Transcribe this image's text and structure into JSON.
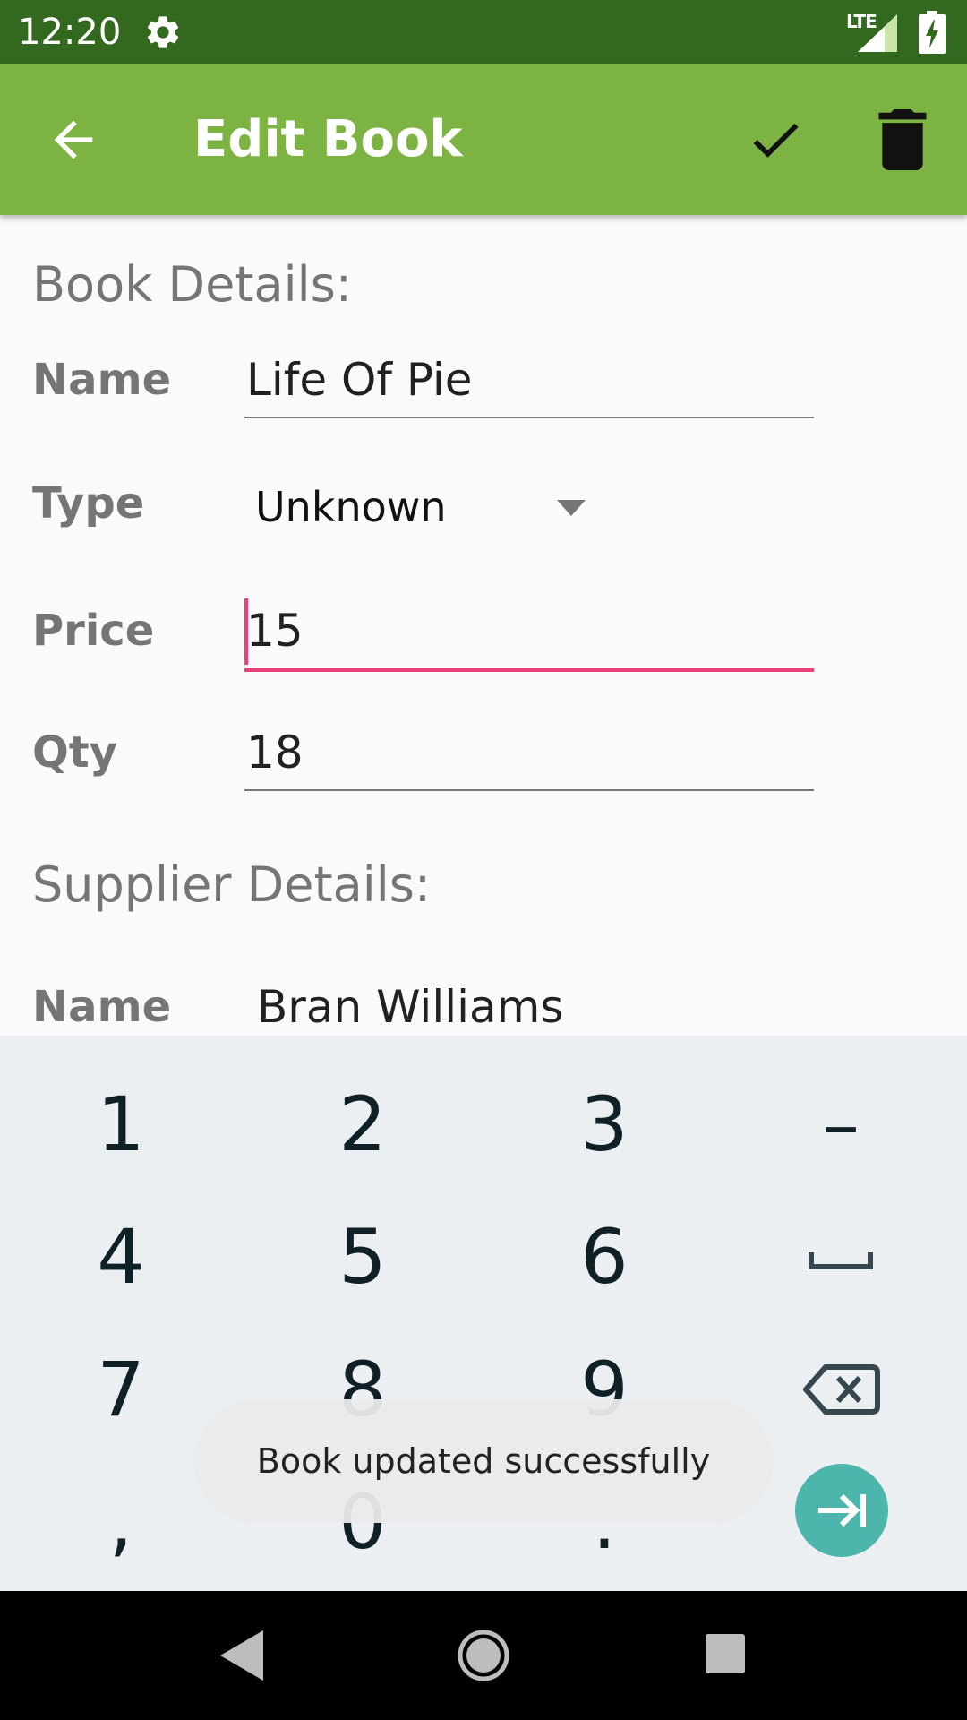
{
  "status_bar": {
    "time": "12:20",
    "network_label": "LTE",
    "icons": [
      "gear-icon",
      "signal-icon",
      "battery-charging-icon"
    ]
  },
  "app_bar": {
    "title": "Edit Book",
    "icons": [
      "arrow-left-icon",
      "check-icon",
      "trash-icon"
    ],
    "background": "#7cb342"
  },
  "book_details": {
    "header": "Book Details:",
    "name_label": "Name",
    "name_value": "Life Of Pie",
    "type_label": "Type",
    "type_value": "Unknown",
    "price_label": "Price",
    "price_value": "15",
    "qty_label": "Qty",
    "qty_value": "18"
  },
  "supplier_details": {
    "header": "Supplier Details:",
    "name_label": "Name",
    "name_value": "Bran Williams"
  },
  "keyboard": {
    "row1": [
      "1",
      "2",
      "3",
      "–"
    ],
    "row2": [
      "4",
      "5",
      "6"
    ],
    "row3": [
      "7",
      "8",
      "9"
    ],
    "row4": [
      ",",
      "0",
      "."
    ],
    "special_icons": [
      "space-icon",
      "backspace-icon",
      "next-field-icon"
    ],
    "accent": "#4db6ac"
  },
  "toast": {
    "message": "Book updated successfully"
  },
  "nav_bar": {
    "icons": [
      "nav-back-icon",
      "nav-home-icon",
      "nav-recents-icon"
    ]
  },
  "colors": {
    "status_bar": "#33691e",
    "focus": "#ec407a"
  }
}
